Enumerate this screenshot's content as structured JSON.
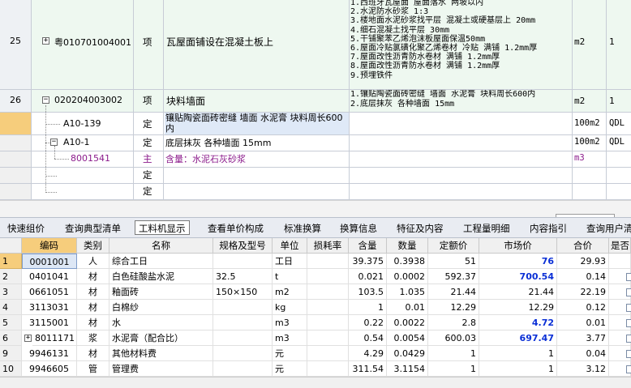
{
  "top_rows": [
    {
      "no": "25",
      "code": "粤010701004001",
      "type": "项",
      "name": "瓦屋面铺设在混凝土板上",
      "desc": [
        "1.西班牙瓦屋面 屋面落水 两坡以内",
        "2.水泥防水砂浆 1:3",
        "3.楼地面水泥砂浆找平层 混凝土或硬基层上 20mm",
        "4.细石混凝土找平层  30mm",
        "5.干铺聚苯乙烯泡沫板屋面保温50mm",
        "6.屋面冷贴氯磺化聚乙烯卷材 冷贴 满铺 1.2mm厚",
        "7.屋面改性沥青防水卷材 满铺 1.2mm厚",
        "8.屋面改性沥青防水卷材 满铺 1.2mm厚",
        "9.预埋铁件"
      ],
      "unit": "m2",
      "qty": "1"
    },
    {
      "no": "26",
      "code": "020204003002",
      "type": "项",
      "name": "块料墙面",
      "desc": [
        "1.镶贴陶瓷面砖密缝 墙面 水泥膏 块料周长600内",
        "2.底层抹灰 各种墙面 15mm"
      ],
      "unit": "m2",
      "qty": "1"
    }
  ],
  "sub_rows": [
    {
      "code": "A10-139",
      "type": "定",
      "name": "镶贴陶瓷面砖密缝 墙面 水泥膏 块料周长600内",
      "unit": "100m2",
      "qty": "QDL"
    },
    {
      "code": "A10-1",
      "type": "定",
      "name": "底层抹灰 各种墙面 15mm",
      "unit": "100m2",
      "qty": "QDL"
    },
    {
      "code": "8001541",
      "type": "主",
      "name": "含量：水泥石灰砂浆",
      "unit": "m3",
      "qty": ""
    },
    {
      "code": "",
      "type": "定",
      "name": "",
      "unit": "",
      "qty": ""
    },
    {
      "code": "",
      "type": "定",
      "name": "",
      "unit": "",
      "qty": ""
    }
  ],
  "tabs": [
    "快速组价",
    "查询典型清单",
    "工料机显示",
    "查看单价构成",
    "标准换算",
    "换算信息",
    "特征及内容",
    "工程量明细",
    "内容指引",
    "查询用户清"
  ],
  "columns": [
    "编码",
    "类别",
    "名称",
    "规格及型号",
    "单位",
    "损耗率",
    "含量",
    "数量",
    "定额价",
    "市场价",
    "合价",
    "是否"
  ],
  "rows": [
    {
      "no": "1",
      "code": "0001001",
      "cat": "人",
      "name": "综合工日",
      "spec": "",
      "unit": "工日",
      "loss": "",
      "content": "39.375",
      "qty": "0.3938",
      "quota": "51",
      "market": "76",
      "total": "29.93"
    },
    {
      "no": "2",
      "code": "0401041",
      "cat": "材",
      "name": "白色硅酸盐水泥",
      "spec": "32.5",
      "unit": "t",
      "loss": "",
      "content": "0.021",
      "qty": "0.0002",
      "quota": "592.37",
      "market": "700.54",
      "total": "0.14"
    },
    {
      "no": "3",
      "code": "0661051",
      "cat": "材",
      "name": "釉面砖",
      "spec": "150×150",
      "unit": "m2",
      "loss": "",
      "content": "103.5",
      "qty": "1.035",
      "quota": "21.44",
      "market": "21.44",
      "total": "22.19"
    },
    {
      "no": "4",
      "code": "3113031",
      "cat": "材",
      "name": "白棉纱",
      "spec": "",
      "unit": "kg",
      "loss": "",
      "content": "1",
      "qty": "0.01",
      "quota": "12.29",
      "market": "12.29",
      "total": "0.12"
    },
    {
      "no": "5",
      "code": "3115001",
      "cat": "材",
      "name": "水",
      "spec": "",
      "unit": "m3",
      "loss": "",
      "content": "0.22",
      "qty": "0.0022",
      "quota": "2.8",
      "market": "4.72",
      "total": "0.01"
    },
    {
      "no": "6",
      "code": "8011171",
      "cat": "浆",
      "name": "水泥膏（配合比）",
      "spec": "",
      "unit": "m3",
      "loss": "",
      "content": "0.54",
      "qty": "0.0054",
      "quota": "600.03",
      "market": "697.47",
      "total": "3.77"
    },
    {
      "no": "9",
      "code": "9946131",
      "cat": "材",
      "name": "其他材料费",
      "spec": "",
      "unit": "元",
      "loss": "",
      "content": "4.29",
      "qty": "0.0429",
      "quota": "1",
      "market": "1",
      "total": "0.04"
    },
    {
      "no": "10",
      "code": "9946605",
      "cat": "管",
      "name": "管理费",
      "spec": "",
      "unit": "元",
      "loss": "",
      "content": "311.54",
      "qty": "3.1154",
      "quota": "1",
      "market": "1",
      "total": "3.12"
    }
  ]
}
